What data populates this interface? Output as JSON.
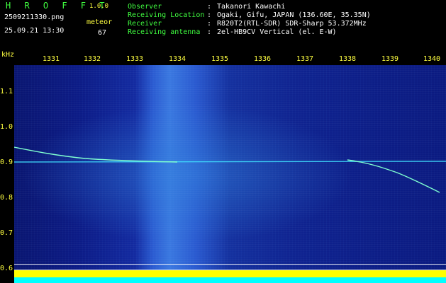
{
  "header": {
    "app_title": "H R O F F T",
    "app_version": "1.0.0",
    "filename": "2509211330.png",
    "datetime": "25.09.21 13:30",
    "event_type": "meteor",
    "event_count": "67"
  },
  "info": [
    {
      "label": "Observer",
      "value": "Takanori Kawachi"
    },
    {
      "label": "Receiving Location",
      "value": "Ogaki, Gifu, JAPAN (136.60E, 35.35N)"
    },
    {
      "label": "Receiver",
      "value": "R820T2(RTL-SDR) SDR-Sharp 53.372MHz"
    },
    {
      "label": "Receiving antenna",
      "value": "2el-HB9CV Vertical (el. E-W)"
    }
  ],
  "plot": {
    "y_unit": "kHz",
    "x_ticks": [
      "1331",
      "1332",
      "1333",
      "1334",
      "1335",
      "1336",
      "1337",
      "1338",
      "1339",
      "1340"
    ],
    "y_ticks": [
      "1.1",
      "1.0",
      "0.9",
      "0.8",
      "0.7",
      "0.6"
    ],
    "colors": {
      "axis": "#ffff40",
      "header_text": "#40ff40",
      "bars": "#ffff00",
      "floor": "#00ffff"
    }
  }
}
